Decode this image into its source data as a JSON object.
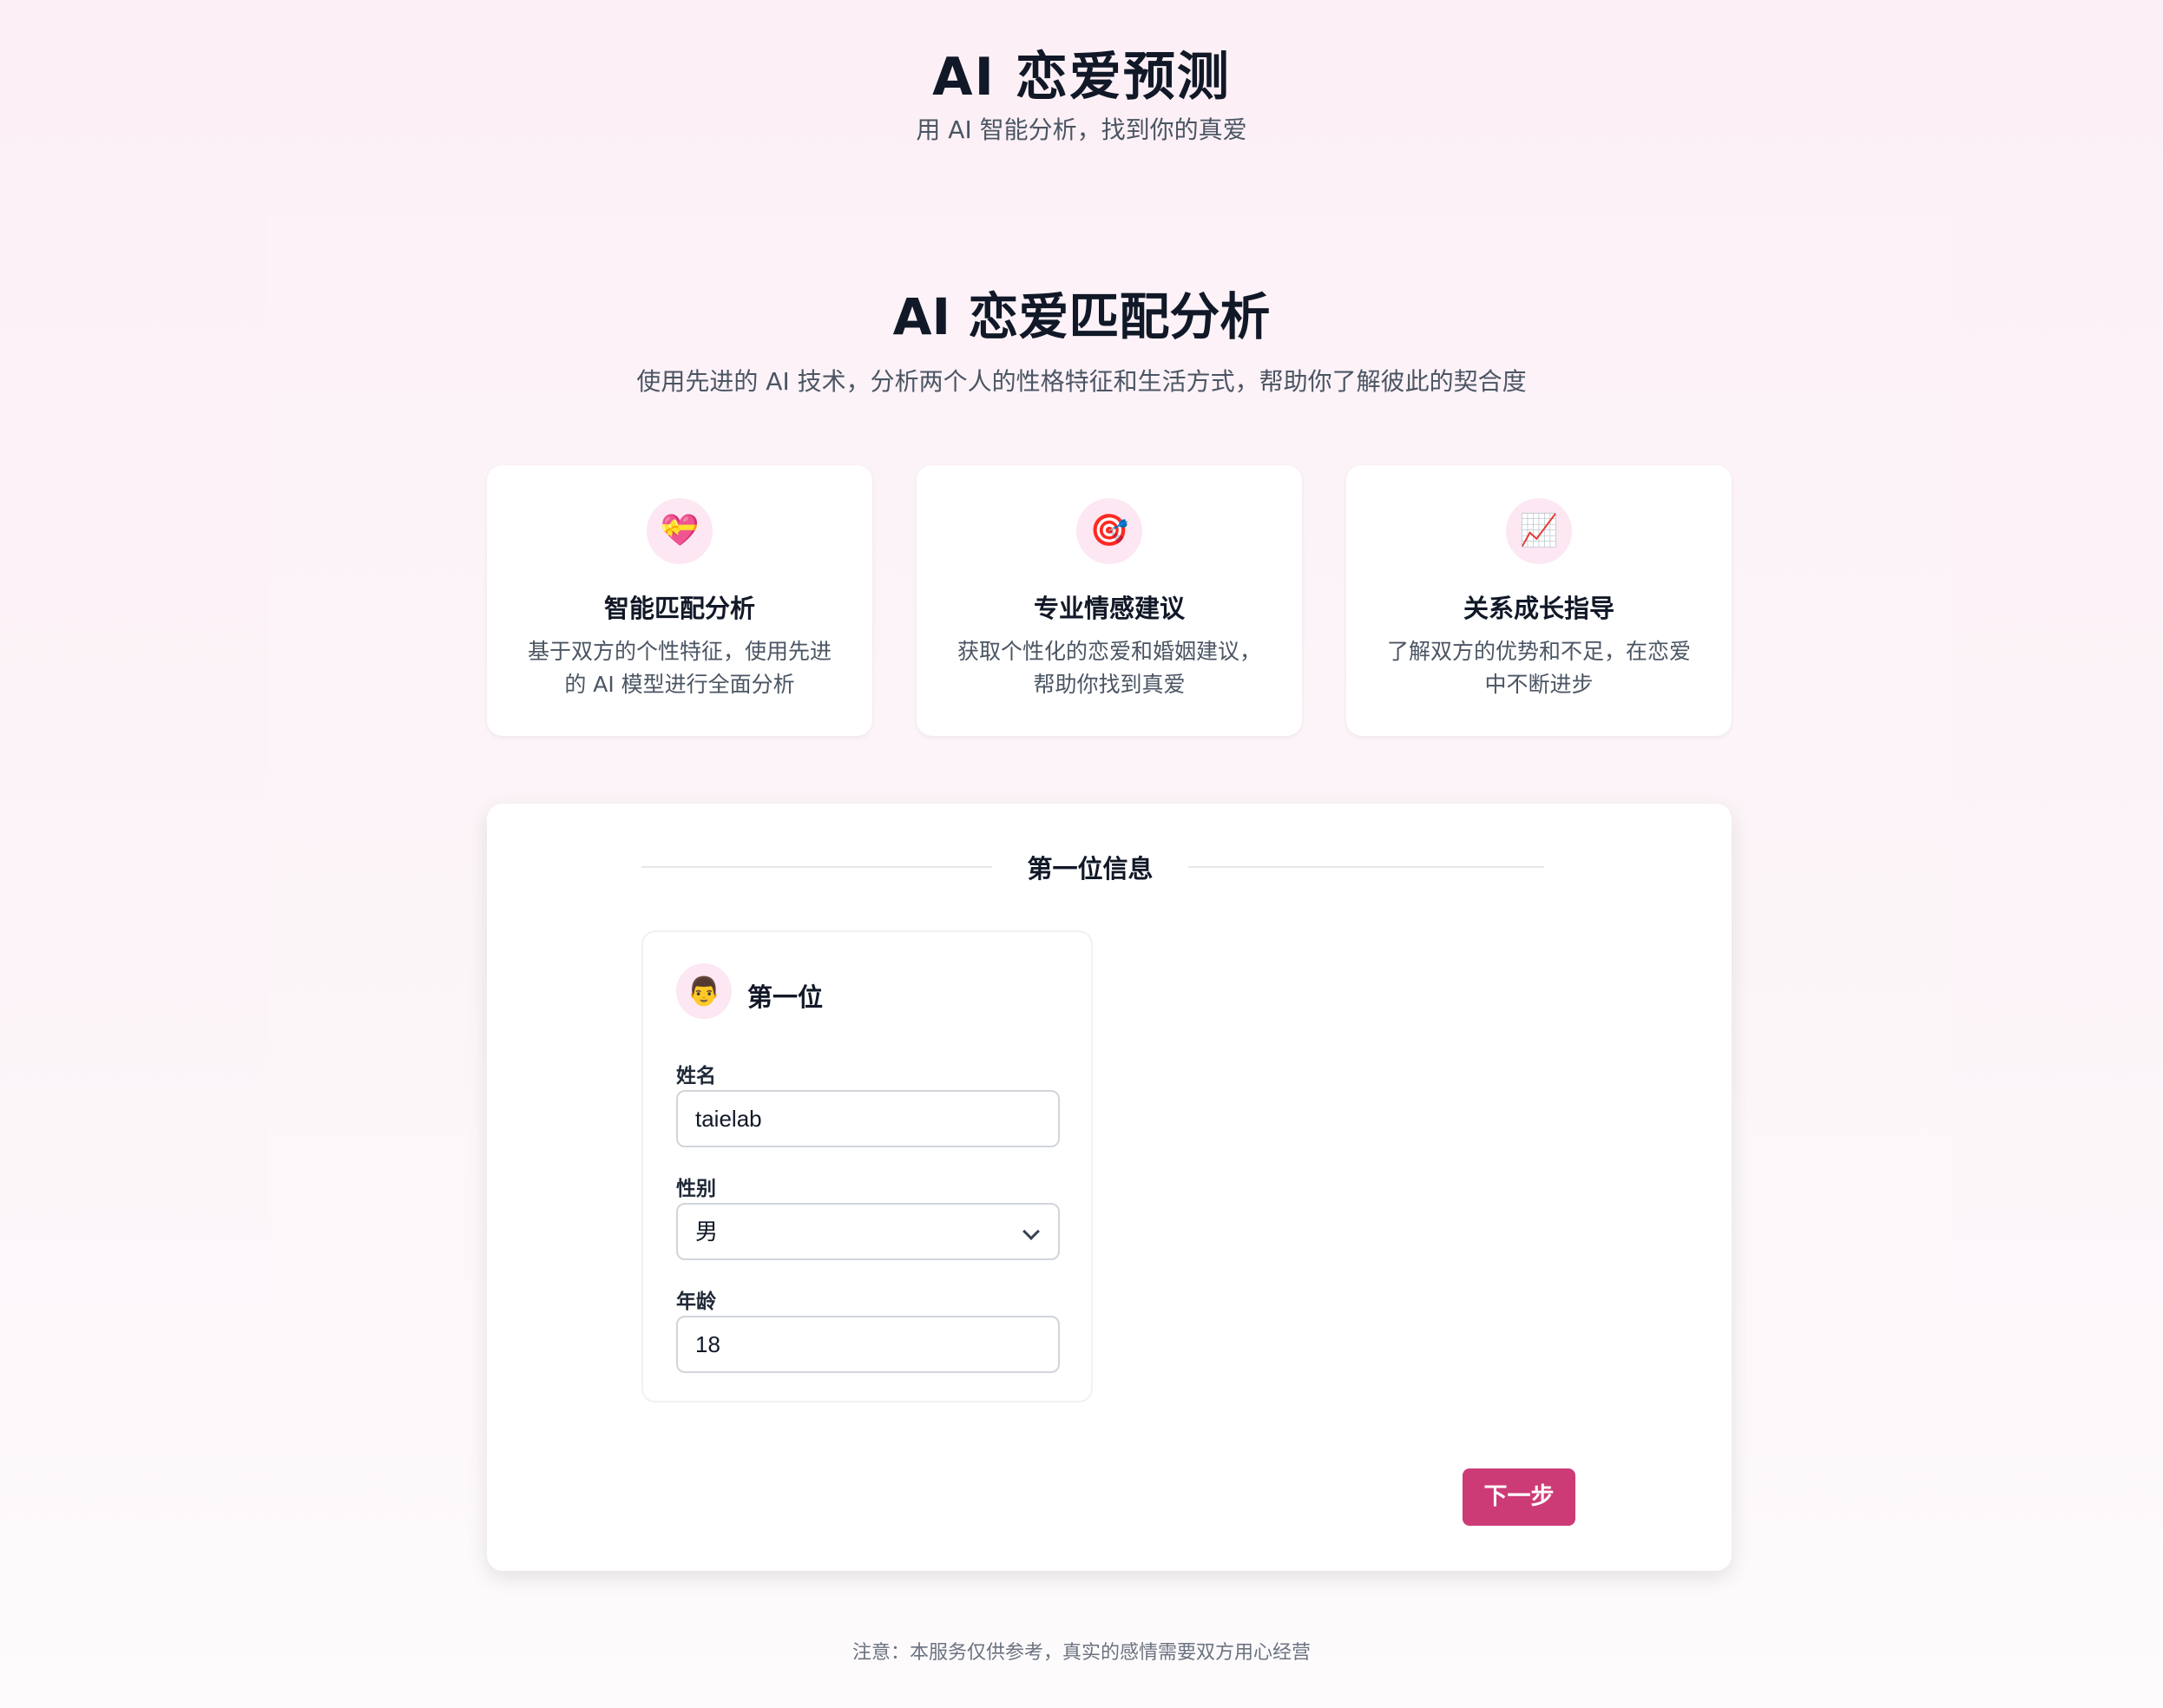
{
  "header": {
    "title": "AI 恋爱预测",
    "subtitle": "用 AI 智能分析，找到你的真爱"
  },
  "intro": {
    "title": "AI 恋爱匹配分析",
    "description": "使用先进的 AI 技术，分析两个人的性格特征和生活方式，帮助你了解彼此的契合度"
  },
  "features": [
    {
      "icon": "💝",
      "icon_name": "heart-gift-icon",
      "title": "智能匹配分析",
      "desc_line1": "基于双方的个性特征，使用先进",
      "desc_line2": "的 AI 模型进行全面分析"
    },
    {
      "icon": "🎯",
      "icon_name": "target-icon",
      "title": "专业情感建议",
      "desc_line1": "获取个性化的恋爱和婚姻建议，",
      "desc_line2": "帮助你找到真爱"
    },
    {
      "icon": "📈",
      "icon_name": "chart-up-icon",
      "title": "关系成长指导",
      "desc_line1": "了解双方的优势和不足，在恋爱",
      "desc_line2": "中不断进步"
    }
  ],
  "form": {
    "step_title": "第一位信息",
    "person": {
      "avatar": "👨",
      "label": "第一位"
    },
    "fields": {
      "name_label": "姓名",
      "name_value": "taielab",
      "gender_label": "性别",
      "gender_value": "男",
      "age_label": "年龄",
      "age_value": "18"
    },
    "next_label": "下一步"
  },
  "footer": {
    "note": "注意：本服务仅供参考，真实的感情需要双方用心经营"
  },
  "colors": {
    "accent": "#cc3b75",
    "icon_bg": "#fce7f3"
  }
}
